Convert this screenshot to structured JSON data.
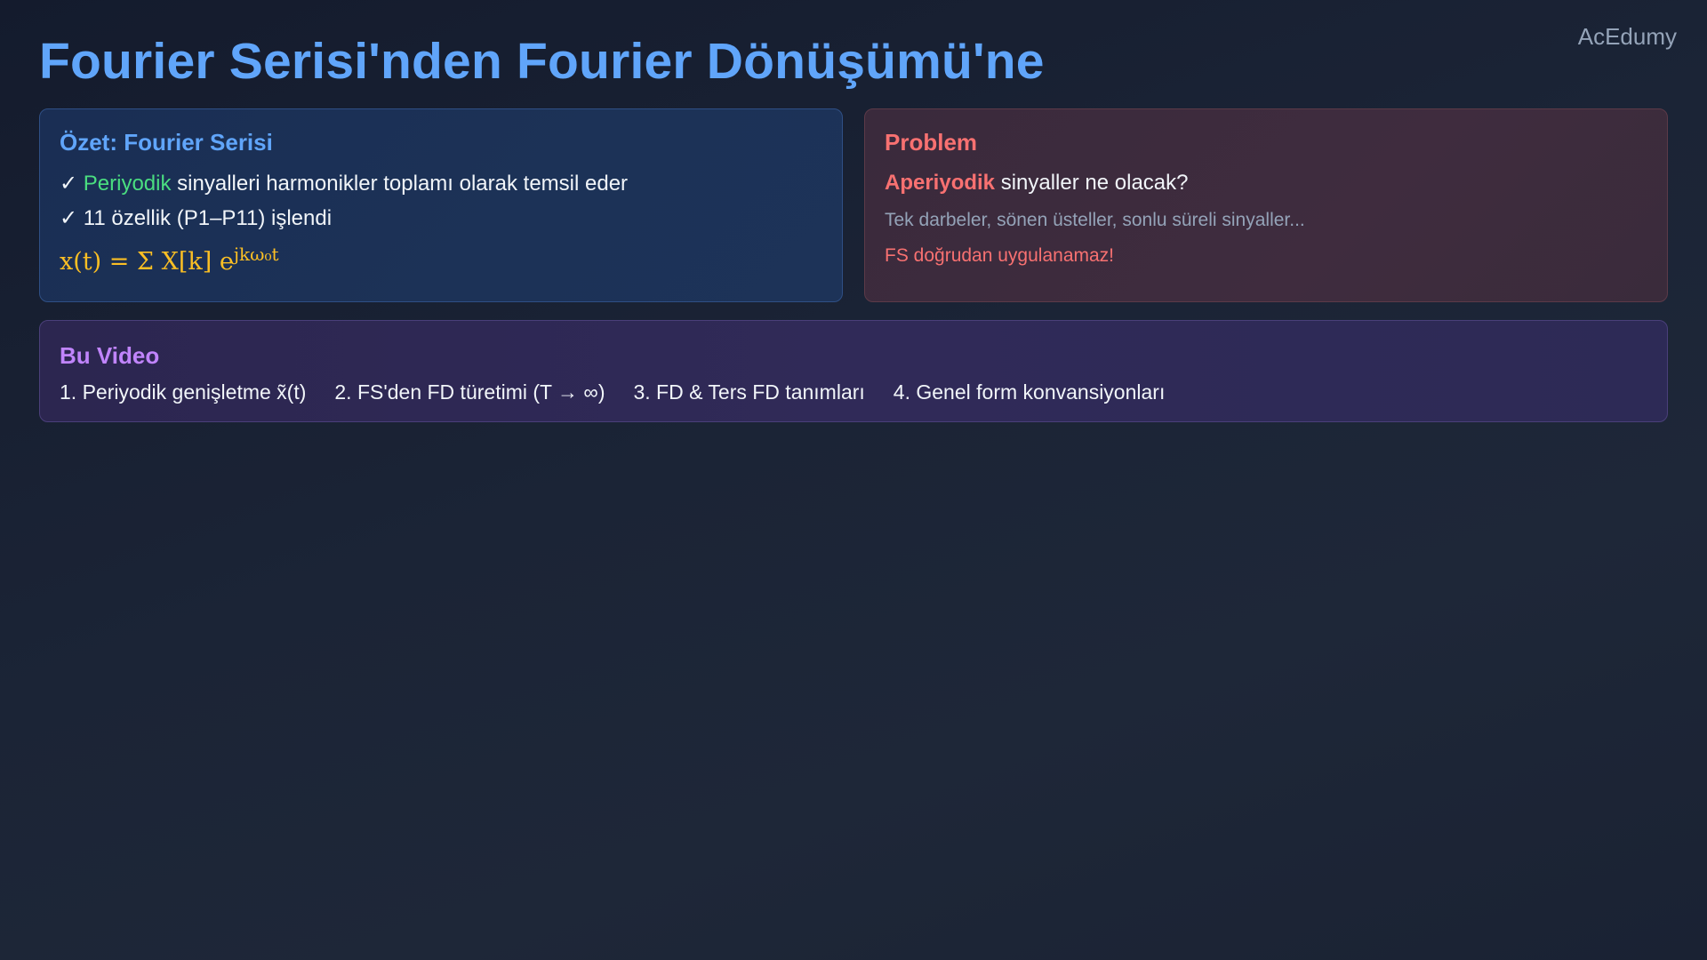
{
  "brand": "AcEdumy",
  "title": "Fourier Serisi'nden Fourier Dönüşümü'ne",
  "summary": {
    "title": "Özet: Fourier Serisi",
    "check": "✓",
    "line1_highlight": "Periyodik",
    "line1_rest": " sinyalleri harmonikler toplamı olarak temsil eder",
    "line2": "11 özellik (P1–P11) işlendi",
    "formula_main": "x(t) = Σ X[k] e",
    "formula_exp": "jkω₀t"
  },
  "problem": {
    "title": "Problem",
    "question_highlight": "Aperiyodik",
    "question_rest": " sinyaller ne olacak?",
    "examples": "Tek darbeler, sönen üsteller, sonlu süreli sinyaller...",
    "warning": "FS doğrudan uygulanamaz!"
  },
  "video": {
    "title": "Bu Video",
    "items": [
      "1. Periyodik genişletme x̃(t)",
      "2. FS'den FD türetimi (T → ∞)",
      "3. FD & Ters FD tanımları",
      "4. Genel form konvansiyonları"
    ]
  },
  "colors": {
    "accent_blue": "#60a5fa",
    "accent_red": "#f87171",
    "accent_purple": "#c084fc",
    "accent_green": "#4ade80",
    "formula_gold": "#fbbf24"
  }
}
